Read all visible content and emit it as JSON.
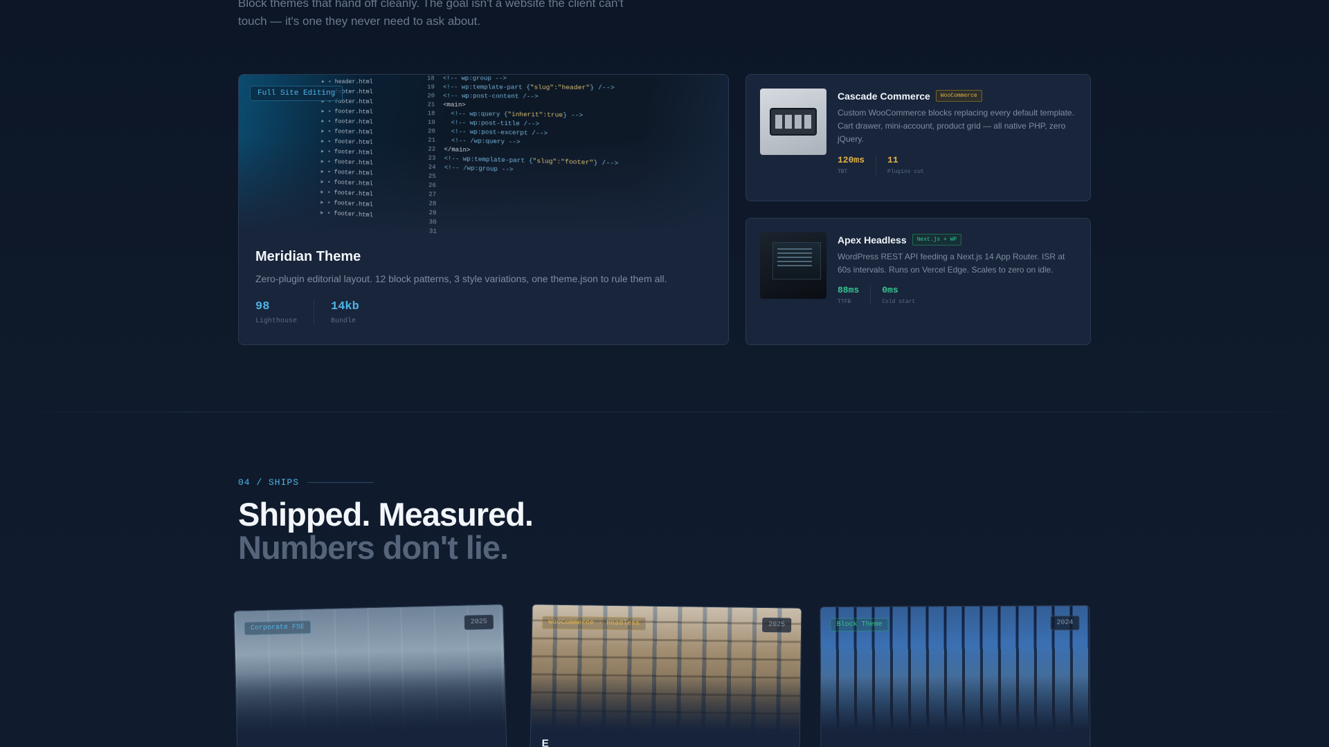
{
  "intro": {
    "text": "Block themes that hand off cleanly. The goal isn't a website the client can't touch — it's one they never need to ask about."
  },
  "feature": {
    "tag": "Full Site Editing",
    "title": "Meridian Theme",
    "description": "Zero-plugin editorial layout. 12 block patterns, 3 style variations, one theme.json to rule them all.",
    "stats": [
      {
        "value": "98",
        "label": "Lighthouse"
      },
      {
        "value": "14kb",
        "label": "Bundle"
      }
    ],
    "code_files": [
      "header.html",
      "footer.html",
      "footer.html",
      "footer.html",
      "footer.html",
      "footer.html",
      "footer.html",
      "footer.html",
      "footer.html",
      "footer.html",
      "footer.html",
      "footer.html",
      "footer.html",
      "footer.html"
    ]
  },
  "side_cards": [
    {
      "title": "Cascade Commerce",
      "badge": "WooCommerce",
      "description": "Custom WooCommerce blocks replacing every default template. Cart drawer, mini-account, product grid — all native PHP, zero jQuery.",
      "stats": [
        {
          "value": "120ms",
          "label": "TBT"
        },
        {
          "value": "11",
          "label": "Plugins cut"
        }
      ]
    },
    {
      "title": "Apex Headless",
      "badge": "Next.js + WP",
      "description": "WordPress REST API feeding a Next.js 14 App Router. ISR at 60s intervals. Runs on Vercel Edge. Scales to zero on idle.",
      "stats": [
        {
          "value": "88ms",
          "label": "TTFB"
        },
        {
          "value": "0ms",
          "label": "Cold start"
        }
      ]
    }
  ],
  "section": {
    "label": "04 / SHIPS",
    "heading_line1": "Shipped. Measured.",
    "heading_line2": "Numbers don't lie."
  },
  "projects": [
    {
      "tag": "Corporate FSE",
      "year": "2025",
      "title": ""
    },
    {
      "tag": "WooCommerce · Headless",
      "year": "2025",
      "title": "E"
    },
    {
      "tag": "Block Theme",
      "year": "2024",
      "title": ""
    }
  ],
  "colors": {
    "background": "#0f1a2b",
    "card": "#18253a",
    "accent_blue": "#4fb3e8",
    "accent_gold": "#e3b24a",
    "accent_green": "#36c48f"
  }
}
